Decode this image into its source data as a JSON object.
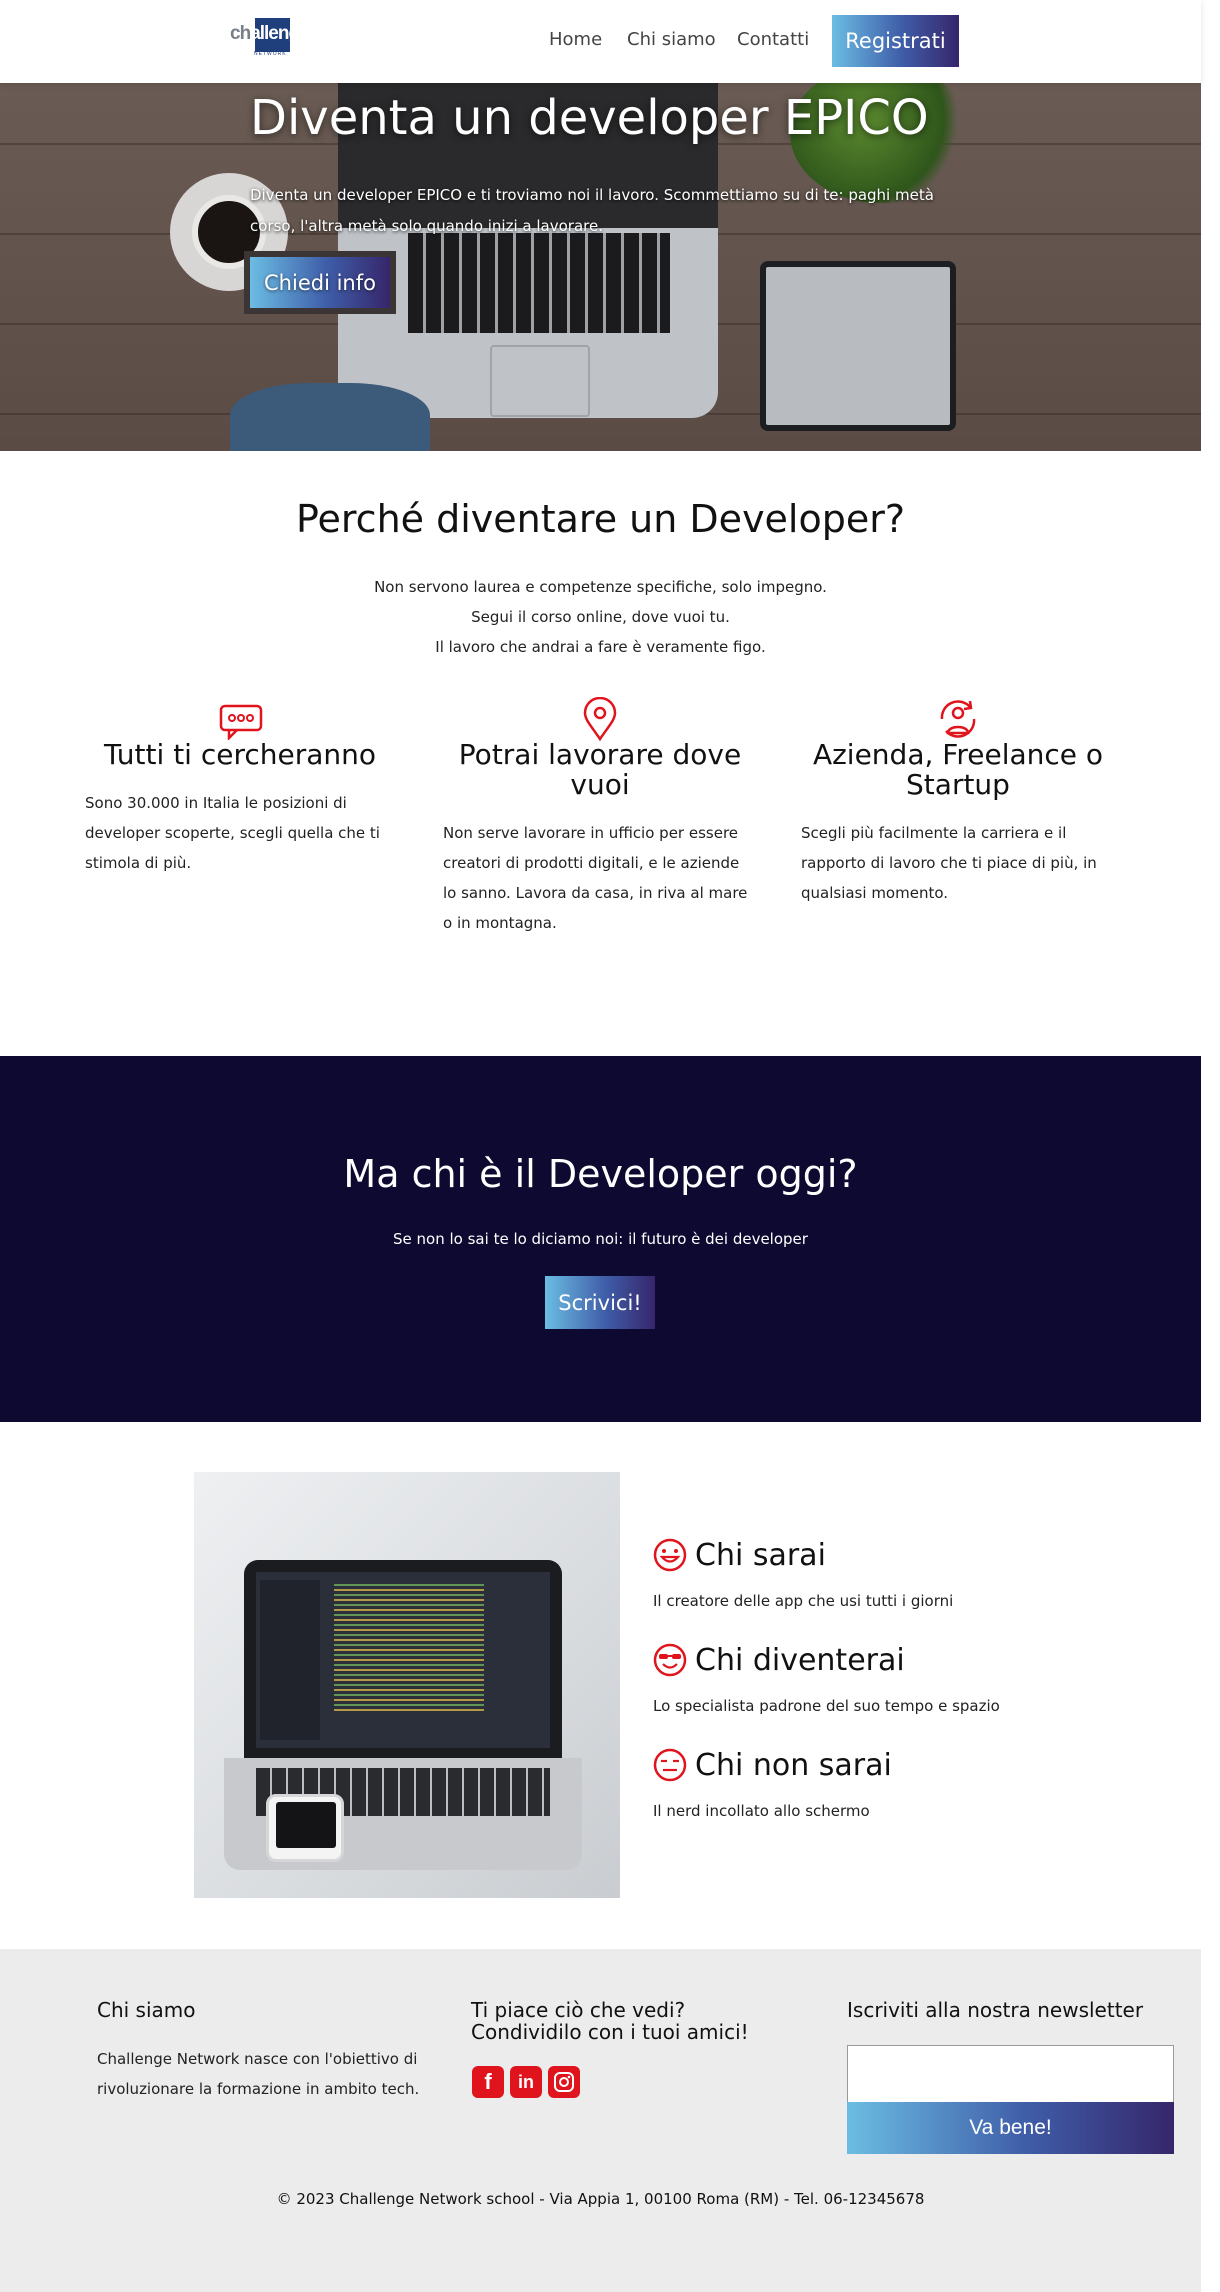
{
  "header": {
    "logo_text_a": "ch",
    "logo_text_b": "allenge",
    "logo_sub": "NETWORK",
    "nav": [
      "Home",
      "Chi siamo",
      "Contatti"
    ],
    "cta": "Registrati"
  },
  "hero": {
    "title": "Diventa un developer EPICO",
    "text": "Diventa un developer EPICO e ti troviamo noi il lavoro. Scommettiamo su di te: paghi metà corso, l'altra metà solo quando inizi a lavorare.",
    "button": "Chiedi info"
  },
  "why": {
    "title": "Perché diventare un Developer?",
    "lines": [
      "Non servono laurea e competenze specifiche, solo impegno.",
      "Segui il corso online, dove vuoi tu.",
      "Il lavoro che andrai a fare è veramente figo."
    ],
    "features": [
      {
        "icon": "chat-bubble-icon",
        "title": "Tutti ti cercheranno",
        "text": "Sono 30.000 in Italia le posizioni di developer scoperte, scegli quella che ti stimola di più."
      },
      {
        "icon": "location-pin-icon",
        "title": "Potrai lavorare dove vuoi",
        "text": "Non serve lavorare in ufficio per essere creatori di prodotti digitali, e le aziende lo sanno. Lavora da casa, in riva al mare o in montagna."
      },
      {
        "icon": "user-refresh-icon",
        "title": "Azienda, Freelance o Startup",
        "text": "Scegli più facilmente la carriera e il rapporto di lavoro che ti piace di più, in qualsiasi momento."
      }
    ]
  },
  "band": {
    "title": "Ma chi è il Developer oggi?",
    "subtitle": "Se non lo sai te lo diciamo noi: il futuro è dei developer",
    "button": "Scrivici!"
  },
  "who": [
    {
      "icon": "smile-icon",
      "title": "Chi sarai",
      "text": "Il creatore delle app che usi tutti i giorni"
    },
    {
      "icon": "cool-face-icon",
      "title": "Chi diventerai",
      "text": "Lo specialista padrone del suo tempo e spazio"
    },
    {
      "icon": "neutral-face-icon",
      "title": "Chi non sarai",
      "text": "Il nerd incollato allo schermo"
    }
  ],
  "footer": {
    "about_title": "Chi siamo",
    "about_text": "Challenge Network nasce con l'obiettivo di rivoluzionare la formazione in ambito tech.",
    "share_title": "Ti piace ciò che vedi? Condividilo con i tuoi amici!",
    "social": [
      "facebook-icon",
      "linkedin-icon",
      "instagram-icon"
    ],
    "newsletter_title": "Iscriviti alla nostra newsletter",
    "newsletter_placeholder": "",
    "newsletter_button": "Va bene!",
    "copyright": "© 2023 Challenge Network school - Via Appia 1, 00100 Roma (RM) - Tel. 06-12345678"
  },
  "colors": {
    "accent_red": "#e0141c",
    "dark_band": "#0d0930",
    "gradient_start": "#6bbde3",
    "gradient_end": "#36266b",
    "footer_bg": "#ececed"
  }
}
